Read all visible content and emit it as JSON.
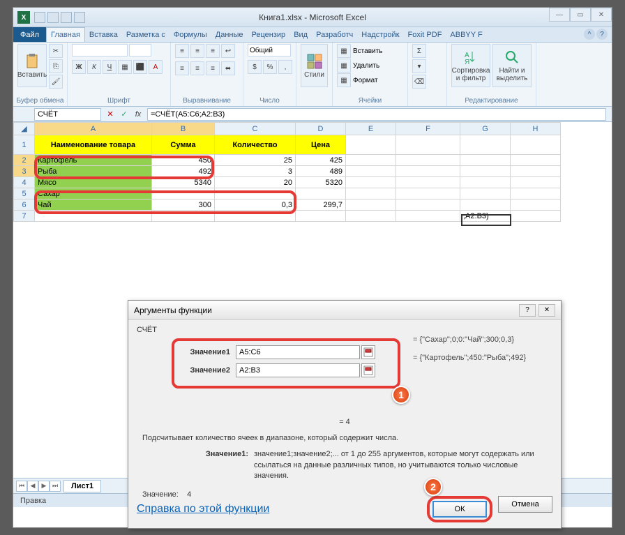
{
  "window": {
    "title": "Книга1.xlsx - Microsoft Excel"
  },
  "tabs": {
    "file": "Файл",
    "items": [
      "Главная",
      "Вставка",
      "Разметка с",
      "Формулы",
      "Данные",
      "Рецензир",
      "Вид",
      "Разработч",
      "Надстройк",
      "Foxit PDF",
      "ABBYY F"
    ]
  },
  "ribbon": {
    "paste": "Вставить",
    "clipboard": "Буфер обмена",
    "font": "Шрифт",
    "align": "Выравнивание",
    "number": "Число",
    "number_fmt": "Общий",
    "styles": "Стили",
    "cells": "Ячейки",
    "editing": "Редактирование",
    "insert": "Вставить",
    "delete": "Удалить",
    "format": "Формат",
    "sort": "Сортировка и фильтр",
    "find": "Найти и выделить"
  },
  "formula": {
    "name": "СЧЁТ",
    "value": "=СЧЁТ(A5:C6;A2:B3)"
  },
  "cols": [
    "A",
    "B",
    "C",
    "D",
    "E",
    "F",
    "G",
    "H"
  ],
  "headers": {
    "a": "Наименование товара",
    "b": "Сумма",
    "c": "Количество",
    "d": "Цена"
  },
  "rows": [
    {
      "a": "Картофель",
      "b": "450",
      "c": "25",
      "d": "425"
    },
    {
      "a": "Рыба",
      "b": "492",
      "c": "3",
      "d": "489"
    },
    {
      "a": "Мясо",
      "b": "5340",
      "c": "20",
      "d": "5320"
    },
    {
      "a": "Сахар",
      "b": "",
      "c": "",
      "d": ""
    },
    {
      "a": "Чай",
      "b": "300",
      "c": "0,3",
      "d": "299,7"
    }
  ],
  "g7": ";A2:B3)",
  "sheet_tab": "Лист1",
  "status": "Правка",
  "dialog": {
    "title": "Аргументы функции",
    "fname": "СЧЁТ",
    "arg1_label": "Значение1",
    "arg1_value": "A5:C6",
    "arg1_preview": "= {\"Сахар\";0;0:\"Чай\";300;0,3}",
    "arg2_label": "Значение2",
    "arg2_value": "A2:B3",
    "arg2_preview": "= {\"Картофель\";450:\"Рыба\";492}",
    "result_mid": "=  4",
    "desc": "Подсчитывает количество ячеек в диапазоне, который содержит числа.",
    "arg_help_label": "Значение1:",
    "arg_help": "значение1;значение2;... от 1 до 255 аргументов, которые могут содержать или ссылаться на данные различных типов, но учитываются только числовые значения.",
    "result_label": "Значение:",
    "result_value": "4",
    "help_link": "Справка по этой функции",
    "ok": "ОК",
    "cancel": "Отмена"
  }
}
